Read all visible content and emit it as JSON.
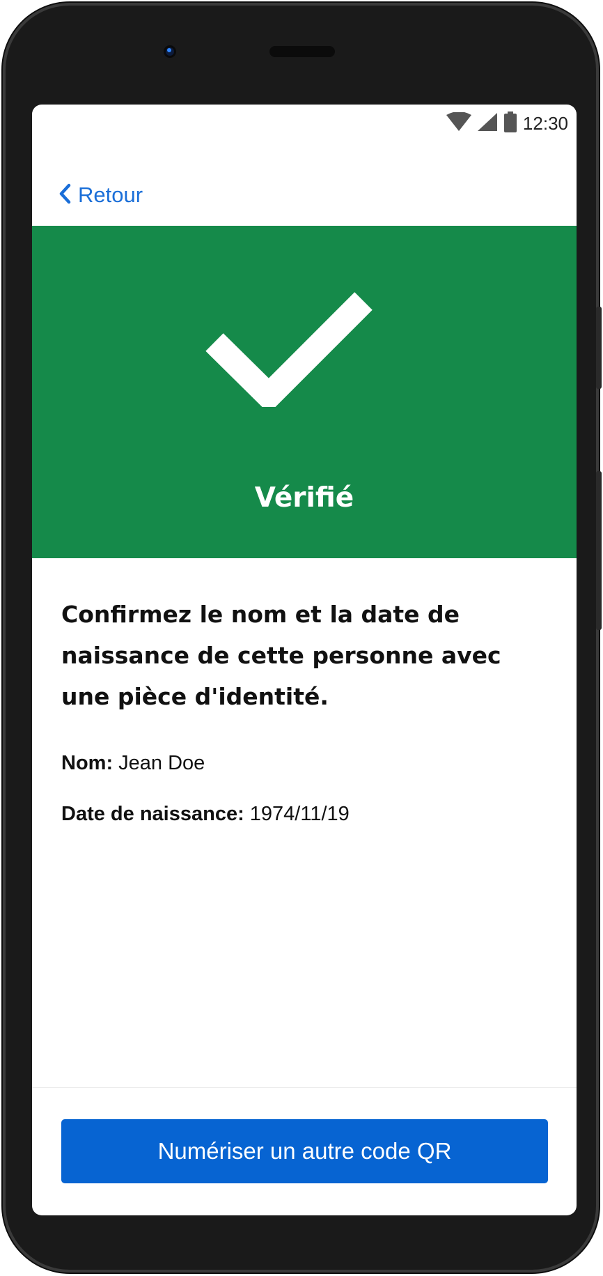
{
  "status_bar": {
    "time": "12:30",
    "icons": [
      "wifi-icon",
      "cellular-signal-icon",
      "battery-icon"
    ]
  },
  "nav": {
    "back_label": "Retour",
    "back_icon": "chevron-left-icon"
  },
  "result": {
    "status_label": "Vérifié",
    "icon": "checkmark-icon"
  },
  "details": {
    "instruction": "Confirmez le nom et la date de naissance de cette personne avec une pièce d'identité.",
    "name_label": "Nom:",
    "name_value": "Jean Doe",
    "dob_label": "Date de naissance:",
    "dob_value": "1974/11/19"
  },
  "footer": {
    "scan_button_label": "Numériser un autre code QR"
  },
  "colors": {
    "success_green": "#158a4a",
    "primary_blue": "#0764d2",
    "link_blue": "#1a6ed8",
    "text": "#111111"
  }
}
